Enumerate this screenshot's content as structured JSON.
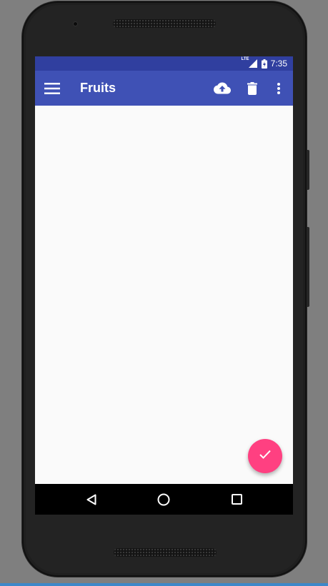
{
  "status_bar": {
    "network": "LTE",
    "time": "7:35"
  },
  "app_bar": {
    "title": "Fruits",
    "menu_icon": "hamburger-menu-icon",
    "actions": [
      {
        "icon": "cloud-upload-icon"
      },
      {
        "icon": "delete-icon"
      },
      {
        "icon": "more-vert-icon"
      }
    ]
  },
  "fab": {
    "icon": "check-icon"
  },
  "nav_bar": {
    "buttons": [
      {
        "icon": "back-triangle-icon"
      },
      {
        "icon": "home-circle-icon"
      },
      {
        "icon": "recents-square-icon"
      }
    ]
  },
  "colors": {
    "primary": "#3f51b5",
    "primary_dark": "#303f9f",
    "accent": "#ff4081",
    "background": "#fafafa"
  }
}
